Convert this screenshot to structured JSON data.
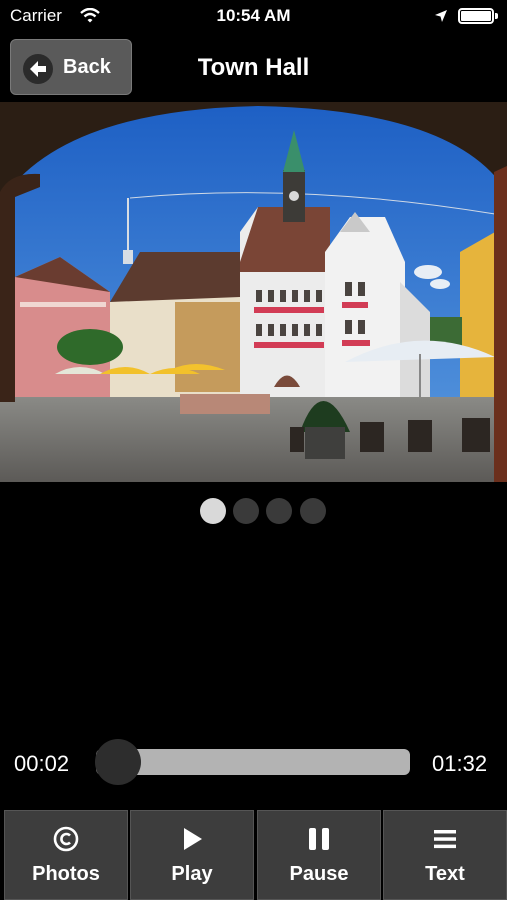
{
  "status_bar": {
    "carrier": "Carrier",
    "time": "10:54 AM",
    "icons": [
      "wifi-icon",
      "location-arrow-icon",
      "battery-icon"
    ]
  },
  "nav": {
    "back_label": "Back",
    "title": "Town Hall"
  },
  "photo": {
    "subject": "town-hall-square-photo"
  },
  "pager": {
    "count": 4,
    "active_index": 0
  },
  "player": {
    "elapsed": "00:02",
    "total": "01:32",
    "progress": 0.022
  },
  "tabs": [
    {
      "label": "Photos",
      "icon": "copyright-icon"
    },
    {
      "label": "Play",
      "icon": "play-icon"
    },
    {
      "label": "Pause",
      "icon": "pause-icon"
    },
    {
      "label": "Text",
      "icon": "menu-lines-icon"
    }
  ],
  "colors": {
    "background": "#000000",
    "button": "#3d3d3d",
    "slider_track": "#b3b3b3",
    "dot_active": "#d9d9d9",
    "dot_inactive": "#3a3a3a"
  }
}
